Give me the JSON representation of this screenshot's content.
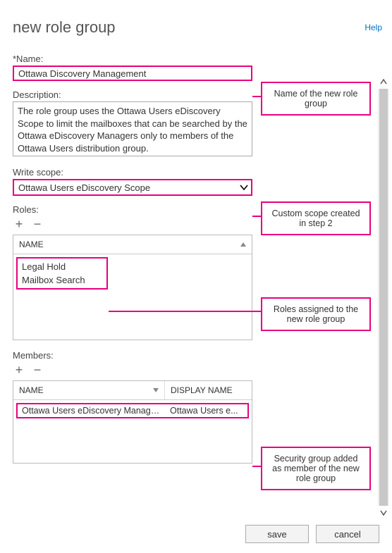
{
  "help_label": "Help",
  "page_title": "new role group",
  "name": {
    "label": "*Name:",
    "value": "Ottawa Discovery Management"
  },
  "description": {
    "label": "Description:",
    "value": "The role group uses the Ottawa Users eDiscovery Scope to limit the mailboxes that can be searched by the Ottawa eDiscovery Managers only to members of the Ottawa Users distribution group."
  },
  "write_scope": {
    "label": "Write scope:",
    "selected": "Ottawa Users eDiscovery Scope"
  },
  "roles": {
    "label": "Roles:",
    "header_name": "NAME",
    "items": [
      "Legal Hold",
      "Mailbox Search"
    ]
  },
  "members": {
    "label": "Members:",
    "header_name": "NAME",
    "header_display": "DISPLAY NAME",
    "rows": [
      {
        "name": "Ottawa Users eDiscovery Managers",
        "display": "Ottawa Users e..."
      }
    ]
  },
  "buttons": {
    "save": "save",
    "cancel": "cancel"
  },
  "callouts": {
    "c1": "Name of the new role group",
    "c2": "Custom scope created in step 2",
    "c3": "Roles assigned to the new role group",
    "c4": "Security group added as member of the new role group"
  }
}
